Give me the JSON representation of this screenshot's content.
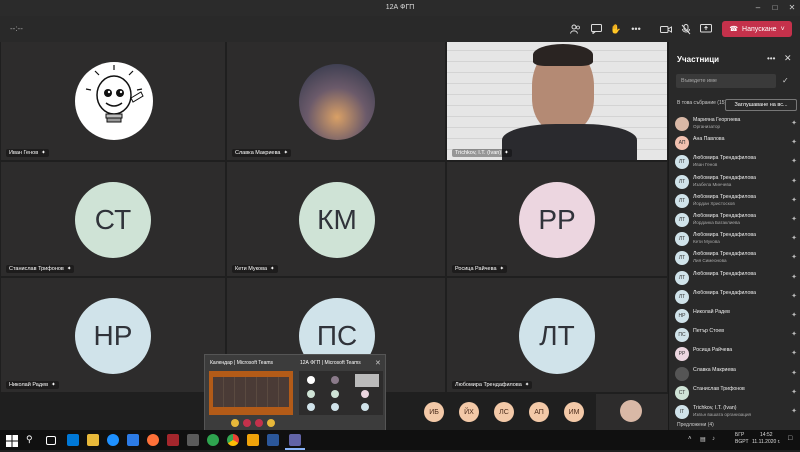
{
  "window": {
    "title": "12А ФГП"
  },
  "toolbar": {
    "timer": "--:--",
    "leave_label": "Напускане"
  },
  "tiles": [
    {
      "name": "Иван Генов",
      "kind": "image"
    },
    {
      "name": "Славка Макриева",
      "kind": "photo"
    },
    {
      "name": "Trichkov, I.T. (Ivan)",
      "kind": "video"
    },
    {
      "name": "Станислав Трифонов",
      "initials": "СТ",
      "color": "#cfe3d6"
    },
    {
      "name": "Кети Мукова",
      "initials": "КМ",
      "color": "#cfe3d6"
    },
    {
      "name": "Росица Райчева",
      "initials": "РР",
      "color": "#ecd6e0"
    },
    {
      "name": "Николай Радев",
      "initials": "НР",
      "color": "#d0e3ea"
    },
    {
      "name": "Петър Стоев",
      "initials": "ПС",
      "color": "#d0e3ea"
    },
    {
      "name": "Любомира Трендафилова",
      "initials": "ЛТ",
      "color": "#d0e3ea"
    }
  ],
  "bottom_avatars": [
    "ИБ",
    "ЙХ",
    "ЛС",
    "АП",
    "ИМ"
  ],
  "panel": {
    "title": "Участници",
    "search_placeholder": "Въведете име",
    "in_meeting": "В това събрание (15)",
    "mute_all": "Заглушаване на вс...",
    "participants": [
      {
        "name": "Марияна Георгиева",
        "sub": "Организатор",
        "initials": "",
        "color": "#d9b8a6"
      },
      {
        "name": "Ана Павлова",
        "sub": "",
        "initials": "АП",
        "color": "#f2c1b0"
      },
      {
        "name": "Любомира Трендафилова",
        "sub": "Иван Генов",
        "initials": "ЛТ",
        "color": "#d0e3ea"
      },
      {
        "name": "Любомира Трендафилова",
        "sub": "Изабела Минчева",
        "initials": "ЛТ",
        "color": "#d0e3ea"
      },
      {
        "name": "Любомира Трендафилова",
        "sub": "Йордан Христосков",
        "initials": "ЛТ",
        "color": "#d0e3ea"
      },
      {
        "name": "Любомира Трендафилова",
        "sub": "Йорданка Батаклиева",
        "initials": "ЛТ",
        "color": "#d0e3ea"
      },
      {
        "name": "Любомира Трендафилова",
        "sub": "Кети Мукова",
        "initials": "ЛТ",
        "color": "#d0e3ea"
      },
      {
        "name": "Любомира Трендафилова",
        "sub": "Лия Симеонова",
        "initials": "ЛТ",
        "color": "#d0e3ea"
      },
      {
        "name": "Любомира Трендафилова",
        "sub": "",
        "initials": "ЛТ",
        "color": "#d0e3ea"
      },
      {
        "name": "Любомира Трендафилова",
        "sub": "",
        "initials": "ЛТ",
        "color": "#d0e3ea"
      },
      {
        "name": "Николай Радев",
        "sub": "",
        "initials": "НР",
        "color": "#d0e3ea"
      },
      {
        "name": "Петър Стоев",
        "sub": "",
        "initials": "ПС",
        "color": "#d0e3ea"
      },
      {
        "name": "Росица Райчева",
        "sub": "",
        "initials": "РР",
        "color": "#ecd6e0"
      },
      {
        "name": "Славка Макриева",
        "sub": "",
        "initials": "",
        "color": "#555"
      },
      {
        "name": "Станислав Трифонов",
        "sub": "",
        "initials": "СТ",
        "color": "#cfe3d6"
      },
      {
        "name": "Trichkov, I.T. (Ivan)",
        "sub": "Извън вашата организация",
        "initials": "IT",
        "color": "#d0e3ea"
      }
    ],
    "footer": "Предложени (4)"
  },
  "popup": {
    "card1_title": "Календар | Microsoft Teams",
    "card2_title": "12А ФГП | Microsoft Teams"
  },
  "taskbar": {
    "lang": "БГР",
    "lang2": "BGPT",
    "time": "14:52",
    "date": "11.11.2020 г."
  }
}
